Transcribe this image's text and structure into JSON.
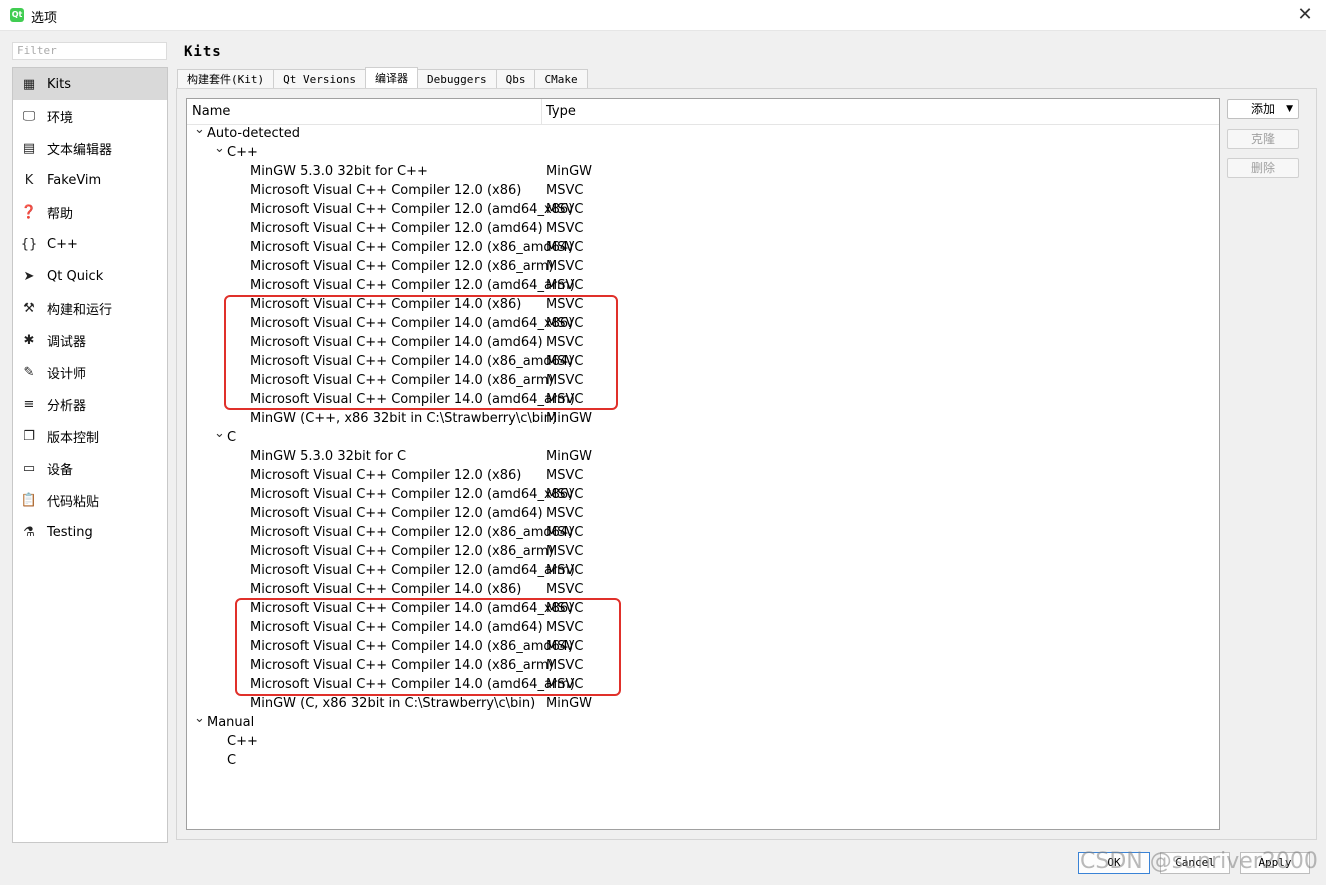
{
  "window": {
    "title": "选项",
    "app_icon_text": "Qt"
  },
  "filter": {
    "placeholder": "Filter"
  },
  "categories": [
    {
      "label": "Kits",
      "icon": "kits-icon",
      "glyph": "▦",
      "selected": true
    },
    {
      "label": "环境",
      "icon": "monitor-icon",
      "glyph": "🖵"
    },
    {
      "label": "文本编辑器",
      "icon": "text-editor-icon",
      "glyph": "▤"
    },
    {
      "label": "FakeVim",
      "icon": "fakevim-icon",
      "glyph": "K"
    },
    {
      "label": "帮助",
      "icon": "help-icon",
      "glyph": "❓"
    },
    {
      "label": "C++",
      "icon": "braces-icon",
      "glyph": "{}"
    },
    {
      "label": "Qt Quick",
      "icon": "qt-quick-icon",
      "glyph": "➤"
    },
    {
      "label": "构建和运行",
      "icon": "hammer-icon",
      "glyph": "⚒"
    },
    {
      "label": "调试器",
      "icon": "bug-icon",
      "glyph": "✱"
    },
    {
      "label": "设计师",
      "icon": "pencil-icon",
      "glyph": "✎"
    },
    {
      "label": "分析器",
      "icon": "analyzer-icon",
      "glyph": "≡"
    },
    {
      "label": "版本控制",
      "icon": "version-control-icon",
      "glyph": "❐"
    },
    {
      "label": "设备",
      "icon": "device-icon",
      "glyph": "▭"
    },
    {
      "label": "代码粘贴",
      "icon": "code-paste-icon",
      "glyph": "📋"
    },
    {
      "label": "Testing",
      "icon": "testing-icon",
      "glyph": "⚗"
    }
  ],
  "page_title": "Kits",
  "tabs": [
    {
      "label": "构建套件(Kit)"
    },
    {
      "label": "Qt Versions"
    },
    {
      "label": "编译器",
      "active": true
    },
    {
      "label": "Debuggers"
    },
    {
      "label": "Qbs"
    },
    {
      "label": "CMake"
    }
  ],
  "tree": {
    "columns": [
      "Name",
      "Type"
    ],
    "rows": [
      {
        "level": 0,
        "expandable": true,
        "name": "Auto-detected",
        "type": ""
      },
      {
        "level": 1,
        "expandable": true,
        "name": "C++",
        "type": ""
      },
      {
        "level": 2,
        "name": "MinGW 5.3.0 32bit for C++",
        "type": "MinGW"
      },
      {
        "level": 2,
        "name": "Microsoft Visual C++ Compiler 12.0 (x86)",
        "type": "MSVC"
      },
      {
        "level": 2,
        "name": "Microsoft Visual C++ Compiler 12.0 (amd64_x86)",
        "type": "MSVC"
      },
      {
        "level": 2,
        "name": "Microsoft Visual C++ Compiler 12.0 (amd64)",
        "type": "MSVC"
      },
      {
        "level": 2,
        "name": "Microsoft Visual C++ Compiler 12.0 (x86_amd64)",
        "type": "MSVC"
      },
      {
        "level": 2,
        "name": "Microsoft Visual C++ Compiler 12.0 (x86_arm)",
        "type": "MSVC"
      },
      {
        "level": 2,
        "name": "Microsoft Visual C++ Compiler 12.0 (amd64_arm)",
        "type": "MSVC"
      },
      {
        "level": 2,
        "name": "Microsoft Visual C++ Compiler 14.0 (x86)",
        "type": "MSVC"
      },
      {
        "level": 2,
        "name": "Microsoft Visual C++ Compiler 14.0 (amd64_x86)",
        "type": "MSVC"
      },
      {
        "level": 2,
        "name": "Microsoft Visual C++ Compiler 14.0 (amd64)",
        "type": "MSVC"
      },
      {
        "level": 2,
        "name": "Microsoft Visual C++ Compiler 14.0 (x86_amd64)",
        "type": "MSVC"
      },
      {
        "level": 2,
        "name": "Microsoft Visual C++ Compiler 14.0 (x86_arm)",
        "type": "MSVC"
      },
      {
        "level": 2,
        "name": "Microsoft Visual C++ Compiler 14.0 (amd64_arm)",
        "type": "MSVC"
      },
      {
        "level": 2,
        "name": "MinGW (C++, x86 32bit in C:\\Strawberry\\c\\bin)",
        "type": "MinGW"
      },
      {
        "level": 1,
        "expandable": true,
        "name": "C",
        "type": ""
      },
      {
        "level": 2,
        "name": "MinGW 5.3.0 32bit for C",
        "type": "MinGW"
      },
      {
        "level": 2,
        "name": "Microsoft Visual C++ Compiler 12.0 (x86)",
        "type": "MSVC"
      },
      {
        "level": 2,
        "name": "Microsoft Visual C++ Compiler 12.0 (amd64_x86)",
        "type": "MSVC"
      },
      {
        "level": 2,
        "name": "Microsoft Visual C++ Compiler 12.0 (amd64)",
        "type": "MSVC"
      },
      {
        "level": 2,
        "name": "Microsoft Visual C++ Compiler 12.0 (x86_amd64)",
        "type": "MSVC"
      },
      {
        "level": 2,
        "name": "Microsoft Visual C++ Compiler 12.0 (x86_arm)",
        "type": "MSVC"
      },
      {
        "level": 2,
        "name": "Microsoft Visual C++ Compiler 12.0 (amd64_arm)",
        "type": "MSVC"
      },
      {
        "level": 2,
        "name": "Microsoft Visual C++ Compiler 14.0 (x86)",
        "type": "MSVC"
      },
      {
        "level": 2,
        "name": "Microsoft Visual C++ Compiler 14.0 (amd64_x86)",
        "type": "MSVC"
      },
      {
        "level": 2,
        "name": "Microsoft Visual C++ Compiler 14.0 (amd64)",
        "type": "MSVC"
      },
      {
        "level": 2,
        "name": "Microsoft Visual C++ Compiler 14.0 (x86_amd64)",
        "type": "MSVC"
      },
      {
        "level": 2,
        "name": "Microsoft Visual C++ Compiler 14.0 (x86_arm)",
        "type": "MSVC"
      },
      {
        "level": 2,
        "name": "Microsoft Visual C++ Compiler 14.0 (amd64_arm)",
        "type": "MSVC"
      },
      {
        "level": 2,
        "name": "MinGW (C, x86 32bit in C:\\Strawberry\\c\\bin)",
        "type": "MinGW"
      },
      {
        "level": 0,
        "expandable": true,
        "name": "Manual",
        "type": ""
      },
      {
        "level": 1,
        "name": "C++",
        "type": ""
      },
      {
        "level": 1,
        "name": "C",
        "type": ""
      }
    ]
  },
  "side_buttons": {
    "add": "添加",
    "clone": "克隆",
    "remove": "删除"
  },
  "bottom_buttons": {
    "ok": "OK",
    "cancel": "Cancel",
    "apply": "Apply"
  },
  "watermark": "CSDN @sunriver2000",
  "colors": {
    "highlight_box": "#e0302a",
    "selected_category": "#d9d9d9",
    "qt_green": "#41cd52"
  }
}
